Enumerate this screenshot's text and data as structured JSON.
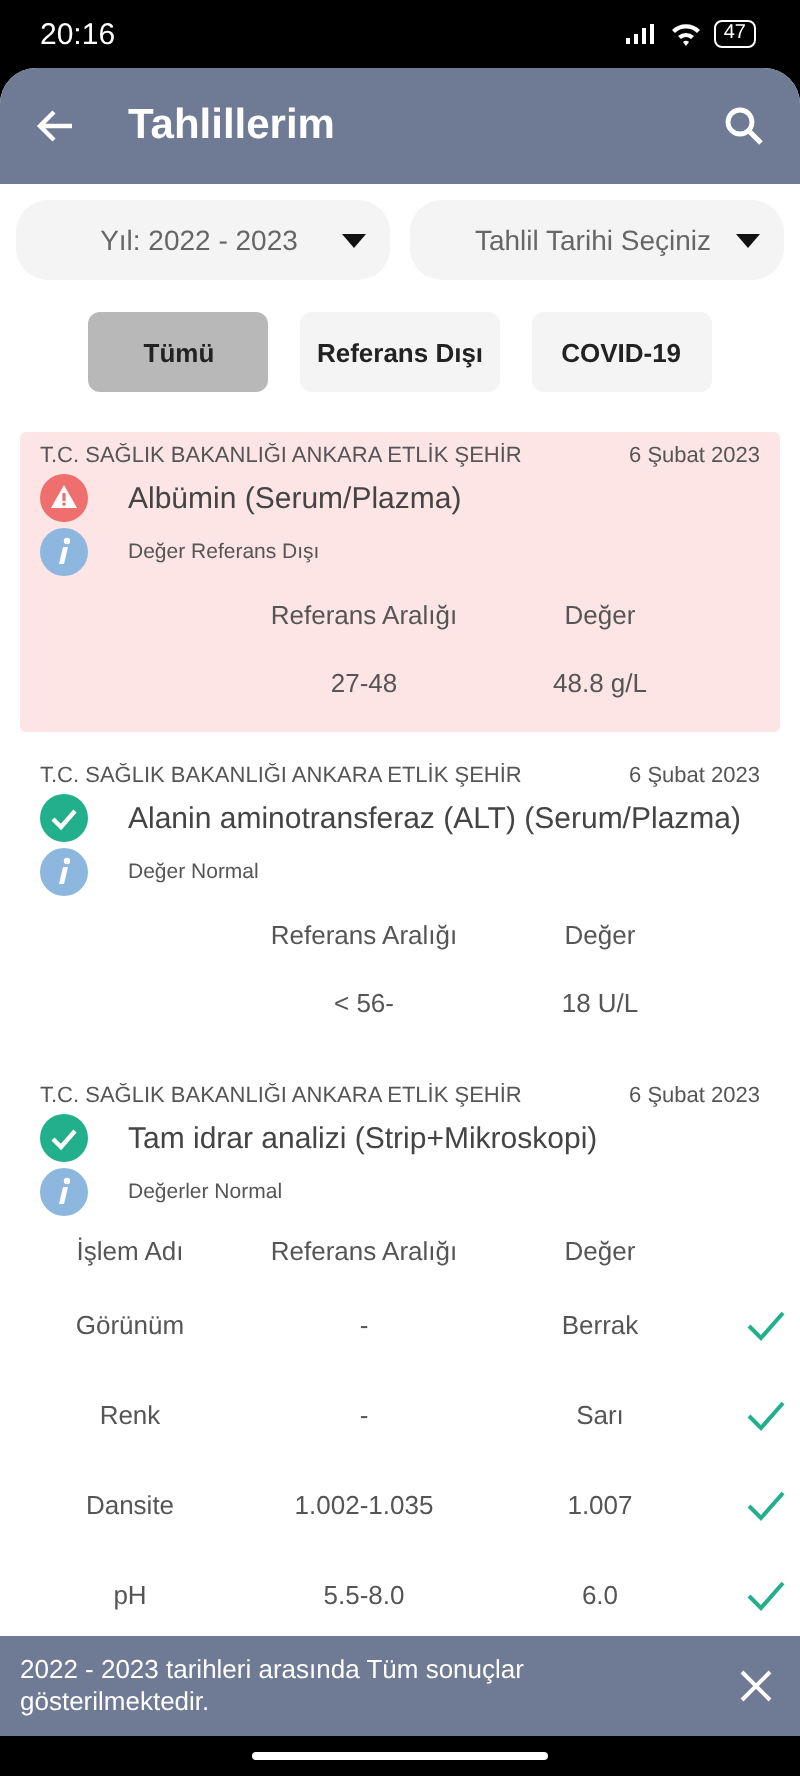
{
  "status_bar": {
    "time": "20:16",
    "battery": "47"
  },
  "header": {
    "title": "Tahlillerim"
  },
  "dropdowns": [
    {
      "value": "Yıl: 2022 - 2023"
    },
    {
      "value": "Tahlil Tarihi Seçiniz"
    }
  ],
  "filters": [
    {
      "label": "Tümü",
      "selected": true
    },
    {
      "label": "Referans Dışı",
      "selected": false
    },
    {
      "label": "COVID-19",
      "selected": false
    }
  ],
  "results": [
    {
      "hospital": "T.C. SAĞLIK BAKANLIĞI ANKARA ETLİK ŞEHİR",
      "date": "6 Şubat 2023",
      "kind": "abnormal",
      "name": "Albümin (Serum/Plazma)",
      "note": "Değer Referans Dışı",
      "columns": [
        "Referans Aralığı",
        "Değer"
      ],
      "rows": [
        {
          "cells": [
            "27-48",
            "48.8 g/L"
          ]
        }
      ]
    },
    {
      "hospital": "T.C. SAĞLIK BAKANLIĞI ANKARA ETLİK ŞEHİR",
      "date": "6 Şubat 2023",
      "kind": "normal",
      "name": "Alanin aminotransferaz (ALT) (Serum/Plazma)",
      "note": "Değer Normal",
      "columns": [
        "Referans Aralığı",
        "Değer"
      ],
      "rows": [
        {
          "cells": [
            "< 56-",
            "18 U/L"
          ]
        }
      ]
    },
    {
      "hospital": "T.C. SAĞLIK BAKANLIĞI ANKARA ETLİK ŞEHİR",
      "date": "6 Şubat 2023",
      "kind": "normal",
      "name": "Tam idrar analizi (Strip+Mikroskopi)",
      "note": "Değerler Normal",
      "columns": [
        "İşlem Adı",
        "Referans Aralığı",
        "Değer"
      ],
      "rows": [
        {
          "cells": [
            "Görünüm",
            "-",
            "Berrak"
          ],
          "checked": true
        },
        {
          "cells": [
            "Renk",
            "-",
            "Sarı"
          ],
          "checked": true
        },
        {
          "cells": [
            "Dansite",
            "1.002-1.035",
            "1.007"
          ],
          "checked": true
        },
        {
          "cells": [
            "pH",
            "5.5-8.0",
            "6.0"
          ],
          "checked": true
        }
      ]
    }
  ],
  "snackbar": {
    "message": "2022 - 2023 tarihleri arasında Tüm sonuçlar gösterilmektedir."
  }
}
